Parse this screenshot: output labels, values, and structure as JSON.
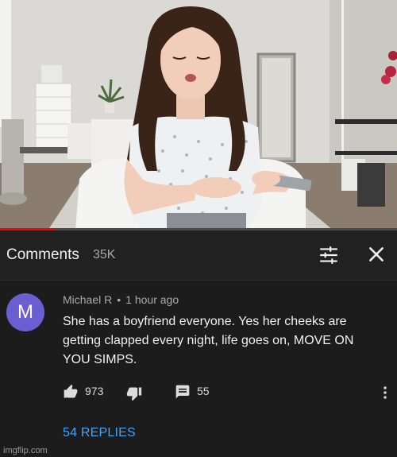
{
  "video": {
    "progress_fraction": 0.14
  },
  "comments_panel": {
    "title": "Comments",
    "count": "35K",
    "sort_icon": "sort-sliders-icon",
    "close_icon": "close-icon"
  },
  "comment": {
    "avatar_initial": "M",
    "avatar_color": "#6a5ed0",
    "author": "Michael R",
    "separator": "•",
    "timestamp": "1 hour ago",
    "text": "She has a boyfriend everyone. Yes her cheeks are getting clapped every night, life goes on, MOVE ON YOU SIMPS.",
    "likes": "973",
    "reply_count": "55",
    "replies_link": "54 REPLIES"
  },
  "watermark": "imgflip.com",
  "colors": {
    "background": "#1c1c1c",
    "header_bg": "#212121",
    "link_blue": "#3ea6ff",
    "progress_red": "#ff0000"
  }
}
